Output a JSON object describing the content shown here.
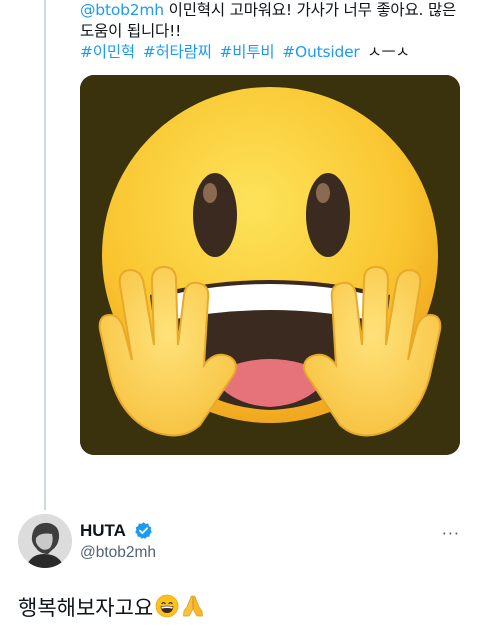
{
  "reply": {
    "handle": "@btob2mh",
    "text_line1": " 이민혁시 고마워요! 가사가 너무 좋아요. 많은",
    "text_line2": "도움이 됩니다!!",
    "hashtags": [
      "#이민혁",
      "#허타람찌",
      "#비투비",
      "#Outsider"
    ],
    "tail": "ㅅㅡㅅ",
    "media_icon": "hugging-face-emoji"
  },
  "tweet": {
    "display_name": "HUTA",
    "verified_icon": "verified-badge-icon",
    "handle": "@btob2mh",
    "more_label": "···",
    "text": "행복해보자고요",
    "emojis": [
      "grinning-face-emoji",
      "folded-hands-emoji"
    ]
  },
  "colors": {
    "link": "#1d9bf0",
    "text": "#0f1419",
    "secondary": "#536471",
    "thread_line": "#cfd9de"
  }
}
